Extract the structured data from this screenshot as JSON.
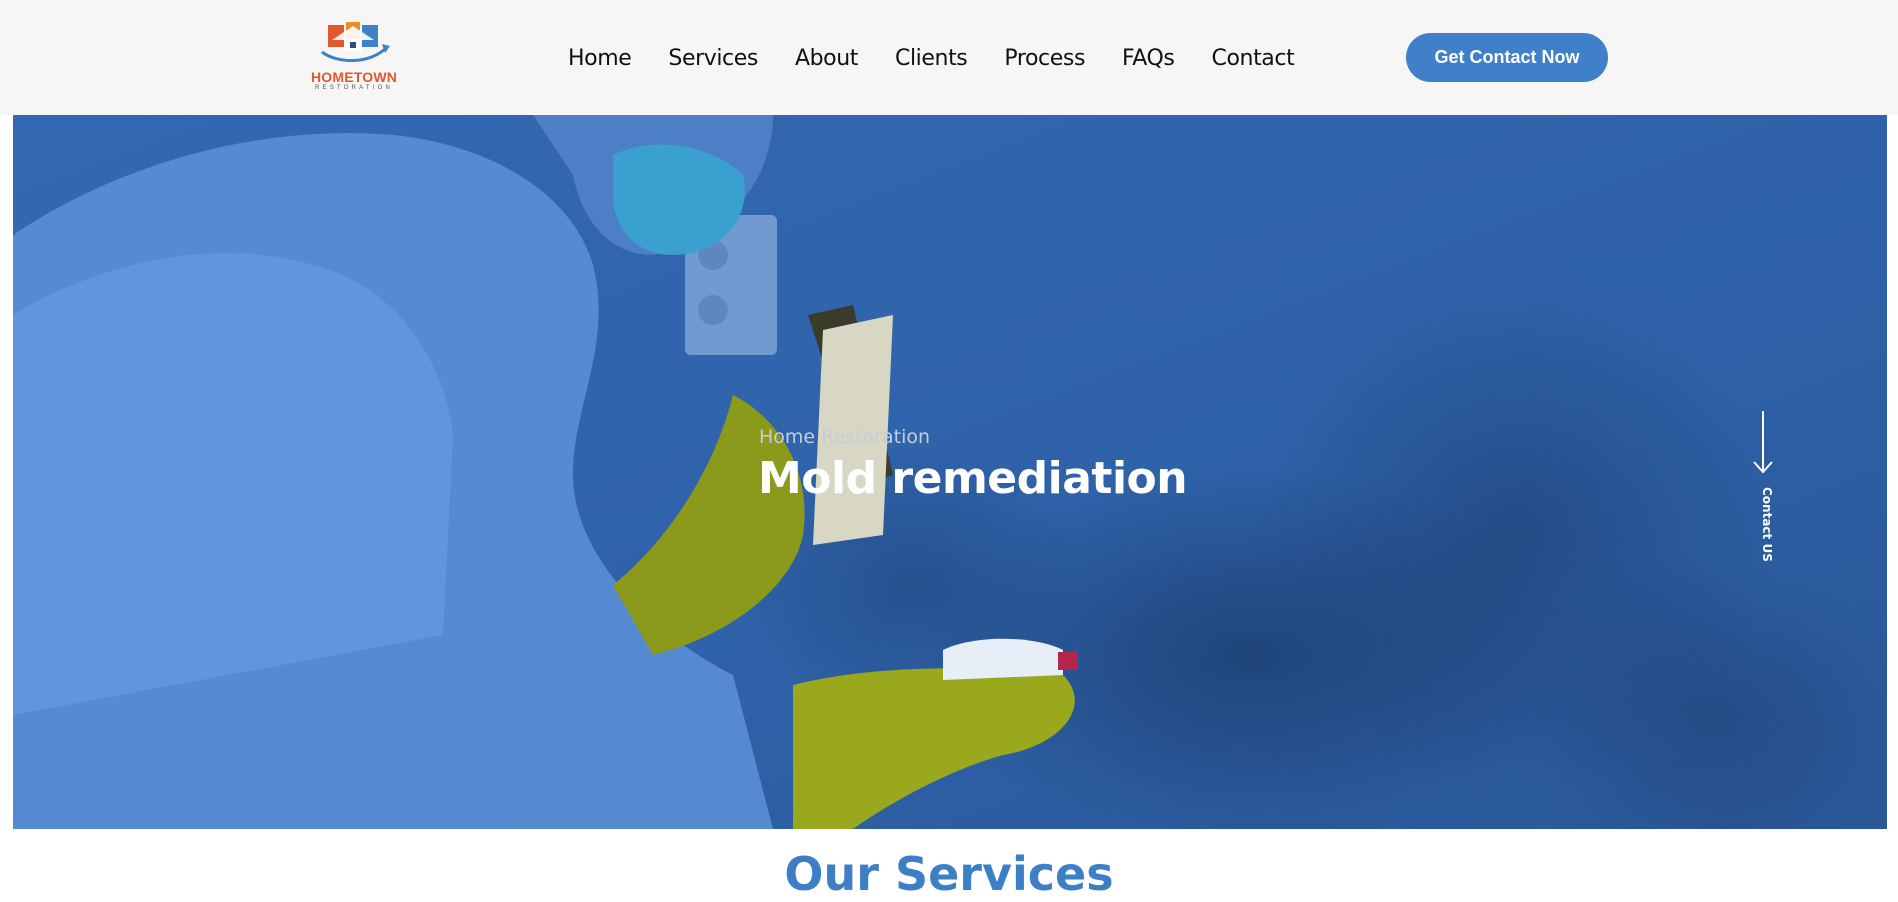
{
  "brand": {
    "name": "HOMETOWN",
    "tagline": "RESTORATION",
    "logo_icon": "house-restoration-logo-icon",
    "colors": {
      "orange": "#e2582a",
      "blue": "#3f80c8"
    }
  },
  "nav": {
    "items": [
      {
        "label": "Home"
      },
      {
        "label": "Services"
      },
      {
        "label": "About"
      },
      {
        "label": "Clients"
      },
      {
        "label": "Process"
      },
      {
        "label": "FAQs"
      },
      {
        "label": "Contact"
      }
    ]
  },
  "header": {
    "cta_label": "Get Contact Now"
  },
  "hero": {
    "eyebrow": "Home Restoration",
    "title": "Mold remediation",
    "side_link_label": "Contact US",
    "side_link_icon": "arrow-down-icon",
    "overlay_color": "#2d5fa6"
  },
  "services": {
    "title": "Our Services"
  }
}
